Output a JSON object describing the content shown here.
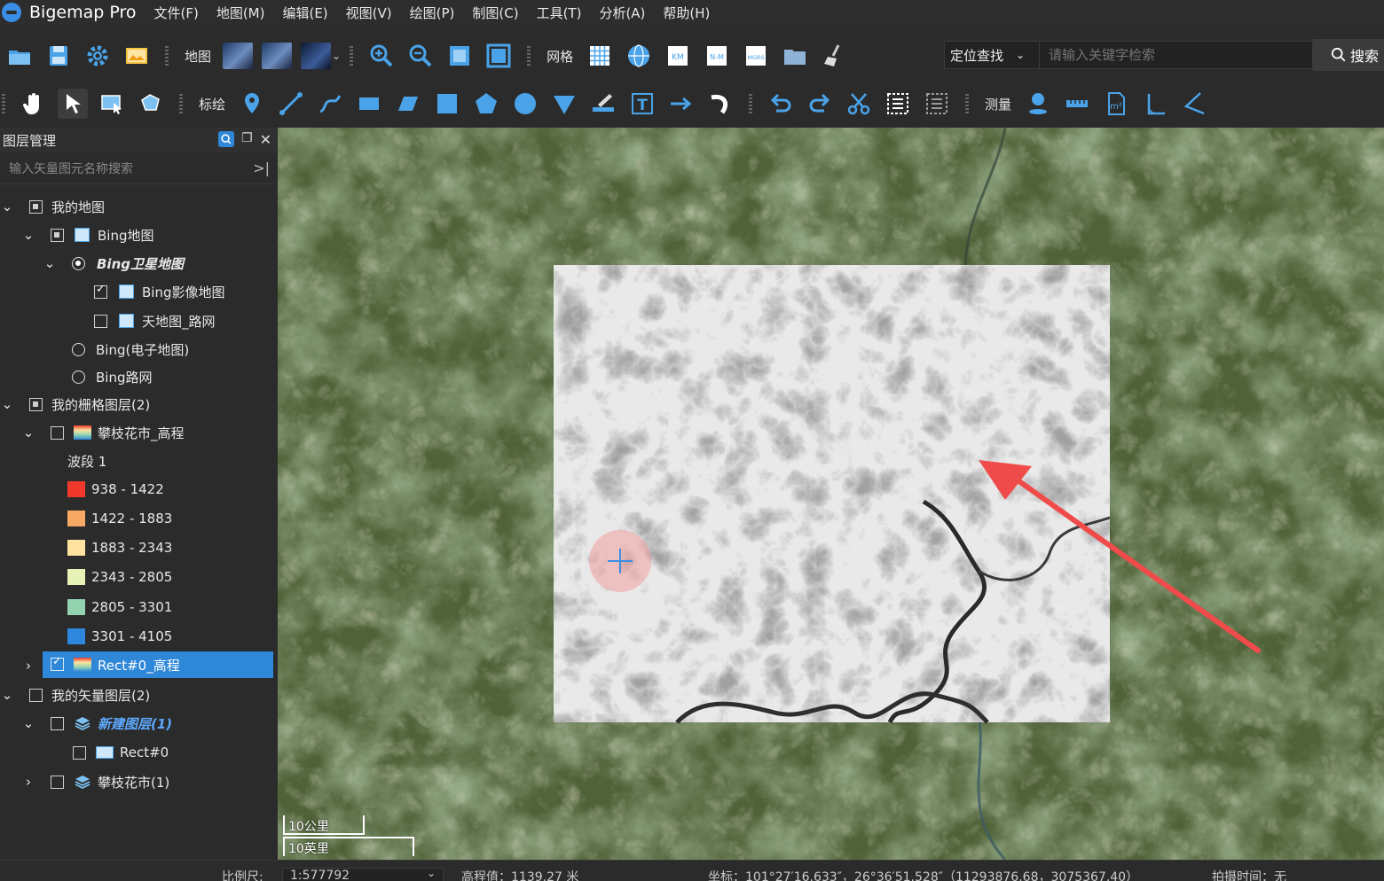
{
  "app": {
    "title": "Bigemap Pro"
  },
  "menu": [
    "文件(F)",
    "地图(M)",
    "编辑(E)",
    "视图(V)",
    "绘图(P)",
    "制图(C)",
    "工具(T)",
    "分析(A)",
    "帮助(H)"
  ],
  "toolbar1": {
    "map_label": "地图",
    "grid_label": "网格"
  },
  "toolbar2": {
    "draw_label": "标绘",
    "measure_label": "测量"
  },
  "search": {
    "mode": "定位查找",
    "placeholder": "请输入关键字检索",
    "button": "搜索"
  },
  "panel": {
    "title": "图层管理",
    "search_placeholder": "输入矢量图元名称搜索",
    "layers": {
      "my_map": "我的地图",
      "bing_map": "Bing地图",
      "bing_satellite": "Bing卫星地图",
      "bing_image": "Bing影像地图",
      "tianditu_road": "天地图_路网",
      "bing_electronic": "Bing(电子地图)",
      "bing_road": "Bing路网",
      "my_raster": "我的栅格图层(2)",
      "panzhihua_dem": "攀枝花市_高程",
      "band": "波段 1",
      "legend": [
        {
          "range": "938 - 1422",
          "color": "#f0392c"
        },
        {
          "range": "1422 - 1883",
          "color": "#f7a862"
        },
        {
          "range": "1883 - 2343",
          "color": "#fde2a0"
        },
        {
          "range": "2343 - 2805",
          "color": "#e6f2b6"
        },
        {
          "range": "2805 - 3301",
          "color": "#93d3b0"
        },
        {
          "range": "3301 - 4105",
          "color": "#2e86dd"
        }
      ],
      "rect_dem": "Rect#0_高程",
      "my_vector": "我的矢量图层(2)",
      "new_layer": "新建图层(1)",
      "rect0": "Rect#0",
      "panzhihua": "攀枝花市(1)"
    }
  },
  "map": {
    "scale_km": "10公里",
    "scale_mi": "10英里"
  },
  "status": {
    "scale_label": "比例尺:",
    "scale_value": "1:577792",
    "elevation": "高程值：1139.27 米",
    "coords": "坐标：101°27′16.633″，26°36′51.528″（11293876.68，3075367.40）",
    "capture_time": "拍摄时间：无"
  }
}
